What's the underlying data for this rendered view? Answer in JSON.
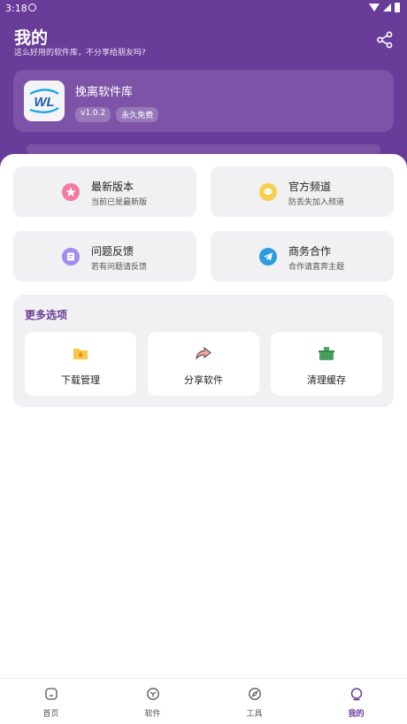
{
  "status": {
    "time": "3:18"
  },
  "header": {
    "title": "我的",
    "subtitle": "这么好用的软件库，不分享给朋友吗?"
  },
  "app": {
    "name": "挽离软件库",
    "version": "v1.0.2",
    "license": "永久免费",
    "logo_text": "WL"
  },
  "quick_actions": [
    {
      "title": "最新版本",
      "subtitle": "当前已是最新版",
      "icon": "star-icon",
      "color": "#f47aa4"
    },
    {
      "title": "官方频道",
      "subtitle": "防丢失加入频道",
      "icon": "chat-icon",
      "color": "#f6cf4f"
    },
    {
      "title": "问题反馈",
      "subtitle": "若有问题请反馈",
      "icon": "feedback-icon",
      "color": "#a58af0"
    },
    {
      "title": "商务合作",
      "subtitle": "合作请直奔主题",
      "icon": "telegram-icon",
      "color": "#2a9de0"
    }
  ],
  "more_options": {
    "title": "更多选项",
    "items": [
      {
        "label": "下载管理",
        "icon": "download-folder-icon"
      },
      {
        "label": "分享软件",
        "icon": "share-arrow-icon"
      },
      {
        "label": "清理缓存",
        "icon": "basket-icon"
      }
    ]
  },
  "nav": [
    {
      "label": "首页",
      "icon": "home-icon",
      "active": false
    },
    {
      "label": "软件",
      "icon": "cube-icon",
      "active": false
    },
    {
      "label": "工具",
      "icon": "compass-icon",
      "active": false
    },
    {
      "label": "我的",
      "icon": "user-icon",
      "active": true
    }
  ],
  "colors": {
    "primary": "#6a3c9a",
    "card_bg": "#f1f1f3"
  }
}
